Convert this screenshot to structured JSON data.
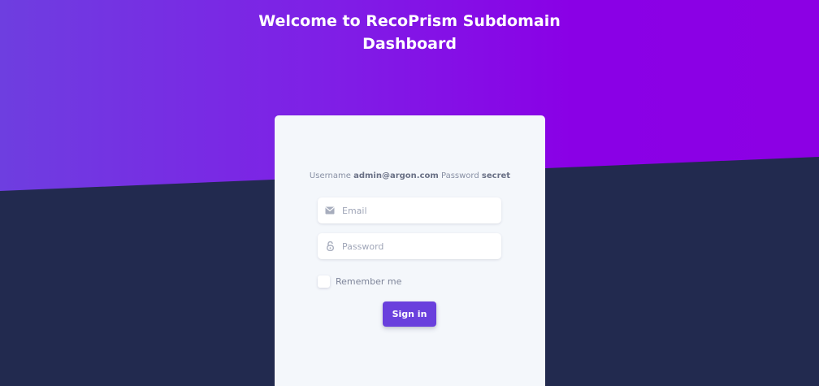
{
  "header": {
    "title_line1": "Welcome to RecoPrism Subdomain",
    "title_line2": "Dashboard"
  },
  "login": {
    "hint": {
      "username_label": "Username",
      "username_value": "admin@argon.com",
      "password_label": "Password",
      "password_value": "secret"
    },
    "email": {
      "placeholder": "Email",
      "value": "",
      "icon": "envelope-icon"
    },
    "password": {
      "placeholder": "Password",
      "value": "",
      "icon": "lock-open-icon"
    },
    "remember_label": "Remember me",
    "remember_checked": false,
    "signin_label": "Sign in"
  },
  "colors": {
    "gradient_start": "#6e3ee0",
    "gradient_end": "#8c00e4",
    "background": "#222a4f",
    "card": "#f4f7fb",
    "button": "#6a40dd"
  }
}
